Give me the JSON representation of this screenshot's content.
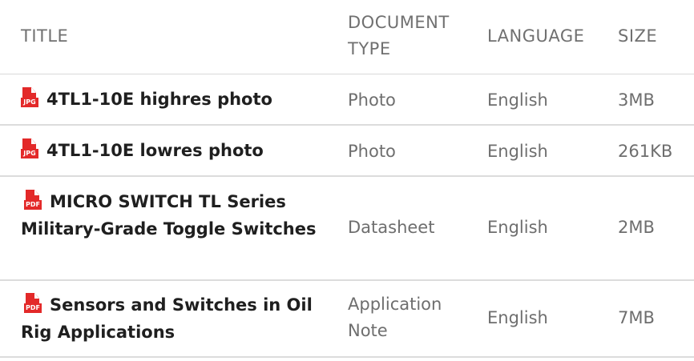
{
  "headers": {
    "title": "TITLE",
    "document_type": "DOCUMENT TYPE",
    "language": "LANGUAGE",
    "size": "SIZE"
  },
  "rows": [
    {
      "file_ext": "JPG",
      "title": "4TL1-10E highres photo",
      "type": "Photo",
      "language": "English",
      "size": "3MB"
    },
    {
      "file_ext": "JPG",
      "title": "4TL1-10E lowres photo",
      "type": "Photo",
      "language": "English",
      "size": "261KB"
    },
    {
      "file_ext": "PDF",
      "title": "MICRO SWITCH TL Series Military-Grade Toggle Switches",
      "type": "Datasheet",
      "language": "English",
      "size": "2MB"
    },
    {
      "file_ext": "PDF",
      "title": "Sensors and Switches in Oil Rig Applications",
      "type": "Application Note",
      "language": "English",
      "size": "7MB"
    }
  ],
  "colors": {
    "file_icon": "#e32929",
    "title_text": "#1f1f1f",
    "muted_text": "#6e6e6e",
    "divider": "#dcdcdc"
  }
}
